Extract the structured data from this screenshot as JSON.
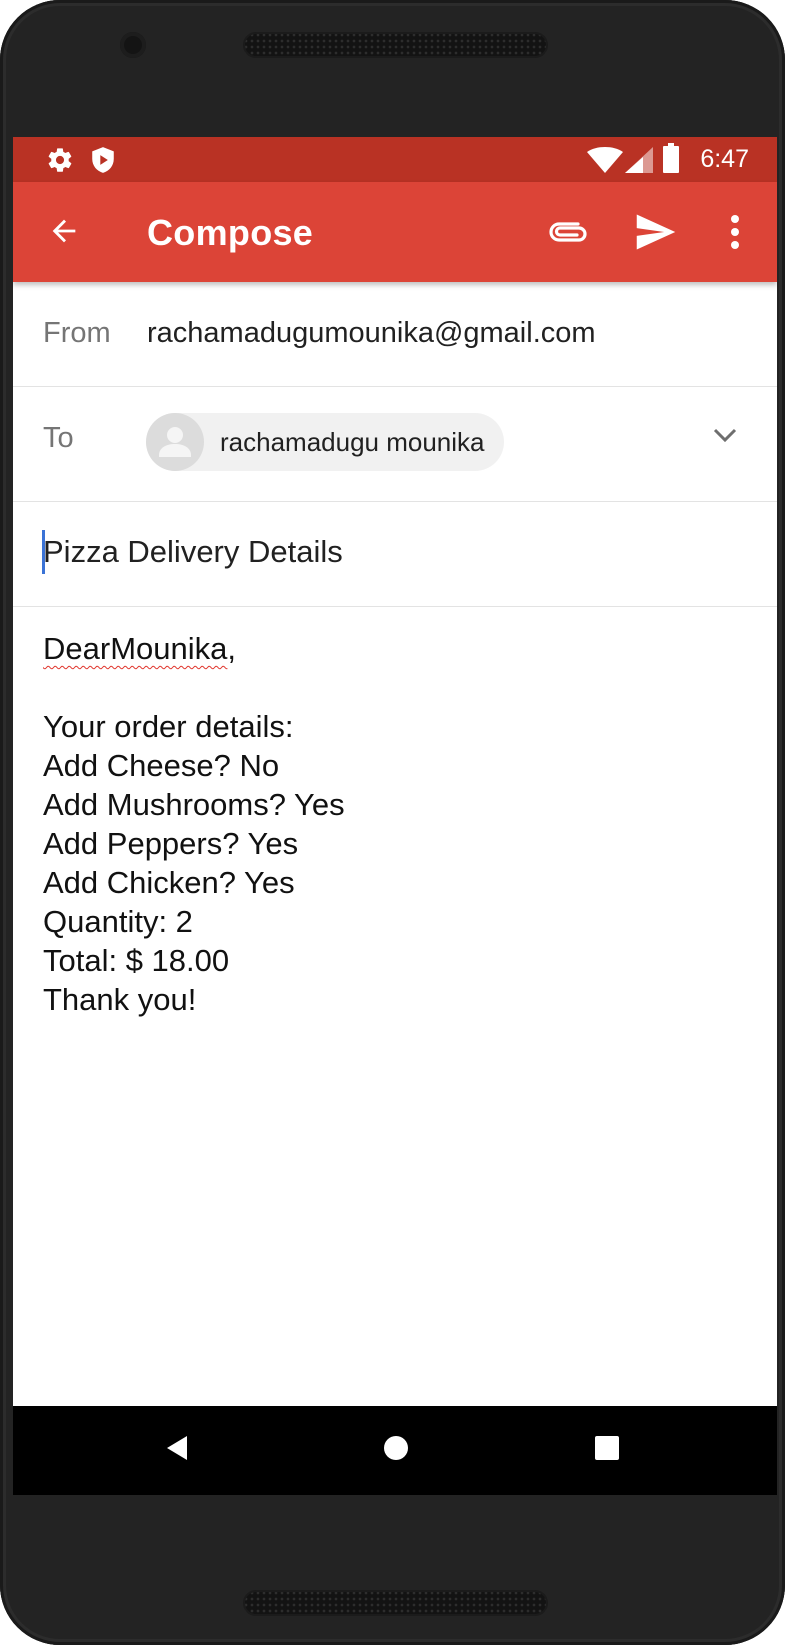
{
  "status_bar": {
    "time": "6:47",
    "icons": [
      "settings-icon",
      "shield-play-icon",
      "wifi-icon",
      "cell-signal-icon",
      "battery-icon"
    ]
  },
  "app_bar": {
    "title": "Compose",
    "icons": [
      "back-arrow-icon",
      "attach-icon",
      "send-icon",
      "more-vert-icon"
    ],
    "color": "#dc4437",
    "status_color": "#b93224"
  },
  "compose": {
    "from_label": "From",
    "from_value": "rachamadugumounika@gmail.com",
    "to_label": "To",
    "to_recipient": "rachamadugu mounika",
    "subject": "Pizza Delivery Details",
    "body": {
      "greeting_name": "DearMounika",
      "greeting_punct": ",",
      "lines": [
        "",
        "Your order details:",
        "Add Cheese? No",
        "Add Mushrooms? Yes",
        "Add Peppers? Yes",
        "Add Chicken? Yes",
        "Quantity: 2",
        "Total: $ 18.00",
        "Thank you!"
      ]
    }
  },
  "nav_bar": {
    "icons": [
      "nav-back-icon",
      "nav-home-icon",
      "nav-recents-icon"
    ]
  }
}
